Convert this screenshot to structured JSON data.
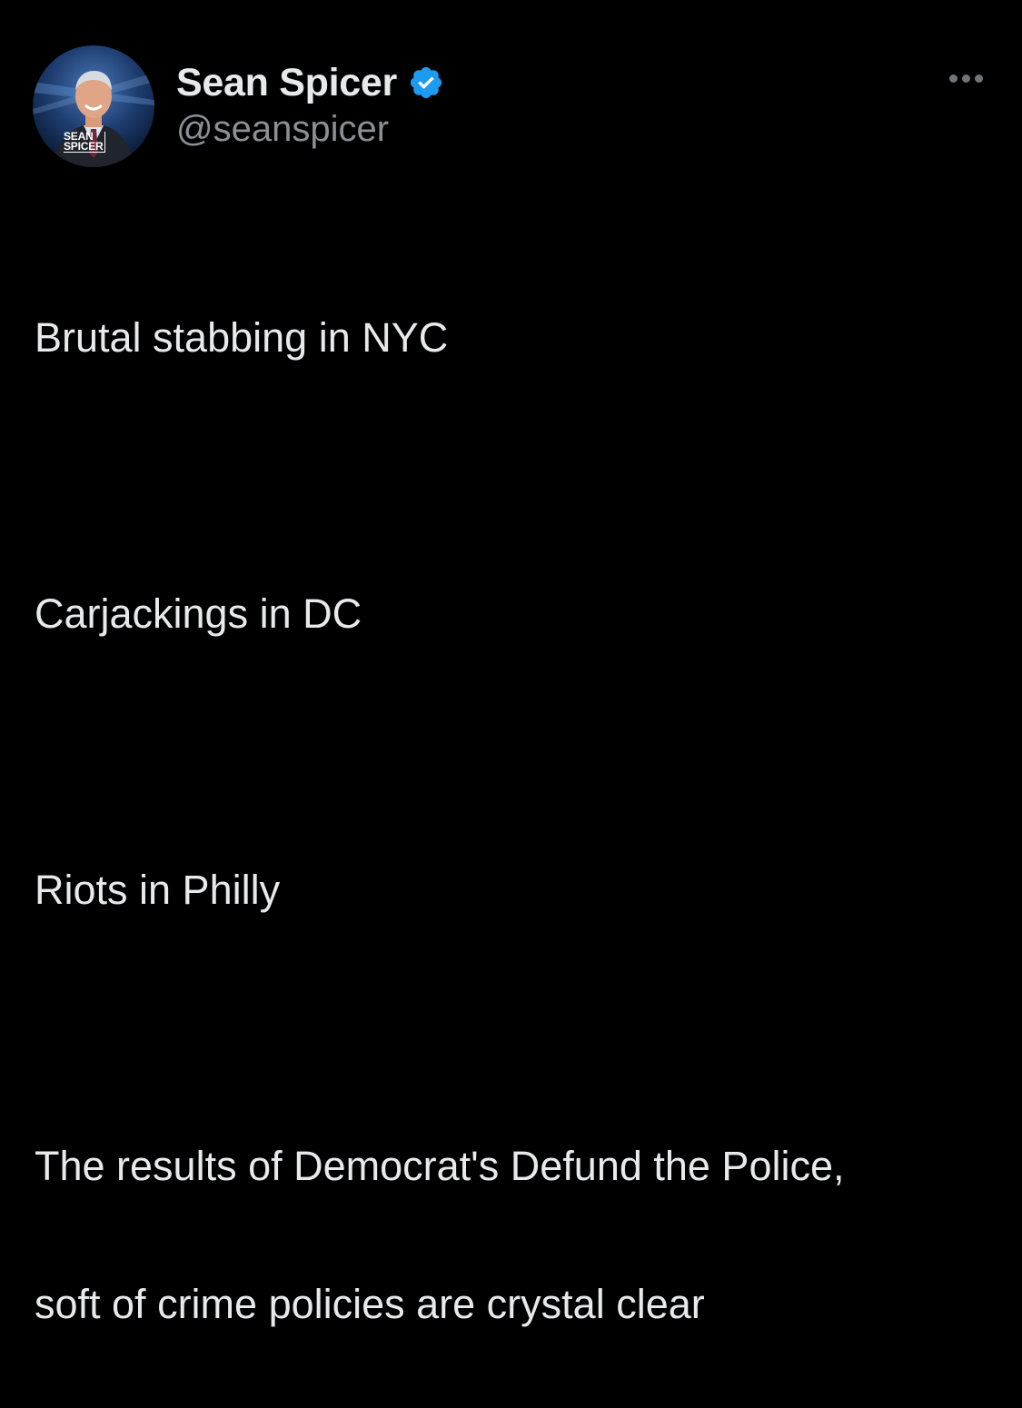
{
  "tweet": {
    "author": {
      "display_name": "Sean Spicer",
      "handle": "@seanspicer",
      "verified": true,
      "avatar_logo_line1": "SEAN",
      "avatar_logo_line2": "SPICER"
    },
    "more_icon": "more-horizontal-icon",
    "lines": [
      "Brutal stabbing in NYC",
      "",
      "Carjackings in DC",
      "",
      "Riots in Philly",
      "",
      "The results of Democrat's Defund the Police,",
      "soft of crime policies are crystal clear"
    ]
  },
  "colors": {
    "background": "#000000",
    "primary_text": "#e7e9ea",
    "secondary_text": "#8b9095",
    "verified_badge": "#1d9bf0"
  }
}
